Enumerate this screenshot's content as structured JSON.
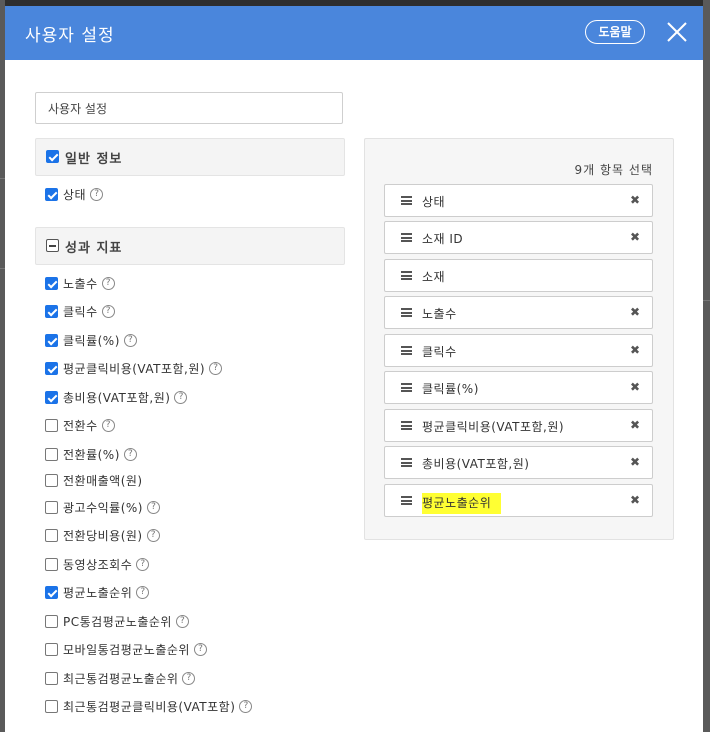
{
  "modal": {
    "title": "사용자 설정",
    "help_label": "도움말",
    "close_icon": "close-icon",
    "header_color": "#4a86dc"
  },
  "name_input": {
    "value": "사용자 설정"
  },
  "sections": {
    "general": {
      "label": "일반 정보",
      "checked": true,
      "items": [
        {
          "label": "상태",
          "checked": true,
          "help": "?"
        }
      ]
    },
    "performance": {
      "label": "성과 지표",
      "state": "mixed",
      "items": [
        {
          "label": "노출수",
          "checked": true,
          "help": "?"
        },
        {
          "label": "클릭수",
          "checked": true,
          "help": "?"
        },
        {
          "label": "클릭률(%)",
          "checked": true,
          "help": "?"
        },
        {
          "label": "평균클릭비용(VAT포함,원)",
          "checked": true,
          "help": "?"
        },
        {
          "label": "총비용(VAT포함,원)",
          "checked": true,
          "help": "?"
        },
        {
          "label": "전환수",
          "checked": false,
          "help": "?"
        },
        {
          "label": "전환률(%)",
          "checked": false,
          "help": "?"
        },
        {
          "label": "전환매출액(원)",
          "checked": false,
          "help": ""
        },
        {
          "label": "광고수익률(%)",
          "checked": false,
          "help": "?"
        },
        {
          "label": "전환당비용(원)",
          "checked": false,
          "help": "?"
        },
        {
          "label": "동영상조회수",
          "checked": false,
          "help": "?"
        },
        {
          "label": "평균노출순위",
          "checked": true,
          "help": "?"
        },
        {
          "label": "PC통검평균노출순위",
          "checked": false,
          "help": "?"
        },
        {
          "label": "모바일통검평균노출순위",
          "checked": false,
          "help": "?"
        },
        {
          "label": "최근통검평균노출순위",
          "checked": false,
          "help": "?"
        },
        {
          "label": "최근통검평균클릭비용(VAT포함)",
          "checked": false,
          "help": "?"
        }
      ]
    }
  },
  "selected": {
    "count_label": "9개 항목 선택",
    "items": [
      {
        "label": "상태",
        "removable": true
      },
      {
        "label": "소재 ID",
        "removable": true
      },
      {
        "label": "소재",
        "removable": false
      },
      {
        "label": "노출수",
        "removable": true
      },
      {
        "label": "클릭수",
        "removable": true
      },
      {
        "label": "클릭률(%)",
        "removable": true
      },
      {
        "label": "평균클릭비용(VAT포함,원)",
        "removable": true
      },
      {
        "label": "총비용(VAT포함,원)",
        "removable": true
      },
      {
        "label": "평균노출순위",
        "removable": true,
        "highlighted": true
      }
    ],
    "remove_glyph": "✖",
    "highlight_color": "#ffff33"
  }
}
